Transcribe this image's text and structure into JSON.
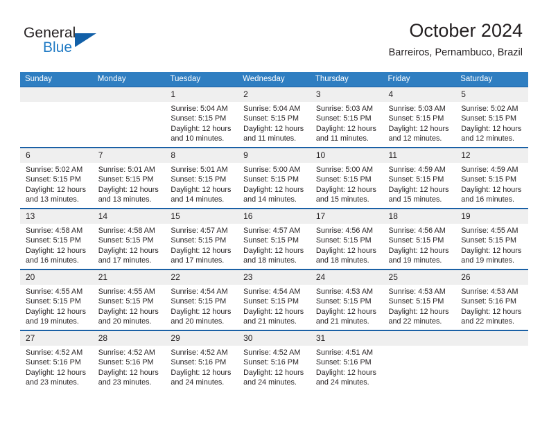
{
  "brand": {
    "name_top": "General",
    "name_bottom": "Blue",
    "triangle_color": "#1260a8",
    "blue_text_color": "#1f7ac4"
  },
  "header": {
    "title": "October 2024",
    "subtitle": "Barreiros, Pernambuco, Brazil"
  },
  "theme": {
    "header_bg": "#2f7ec1",
    "row_border": "#1a60a5",
    "daynum_bg": "#efefef",
    "text": "#231f20"
  },
  "weekday_headers": [
    "Sunday",
    "Monday",
    "Tuesday",
    "Wednesday",
    "Thursday",
    "Friday",
    "Saturday"
  ],
  "weeks": [
    [
      {
        "day": "",
        "blank": true
      },
      {
        "day": "",
        "blank": true
      },
      {
        "day": "1",
        "sunrise": "Sunrise: 5:04 AM",
        "sunset": "Sunset: 5:15 PM",
        "daylight_line1": "Daylight: 12 hours",
        "daylight_line2": "and 10 minutes."
      },
      {
        "day": "2",
        "sunrise": "Sunrise: 5:04 AM",
        "sunset": "Sunset: 5:15 PM",
        "daylight_line1": "Daylight: 12 hours",
        "daylight_line2": "and 11 minutes."
      },
      {
        "day": "3",
        "sunrise": "Sunrise: 5:03 AM",
        "sunset": "Sunset: 5:15 PM",
        "daylight_line1": "Daylight: 12 hours",
        "daylight_line2": "and 11 minutes."
      },
      {
        "day": "4",
        "sunrise": "Sunrise: 5:03 AM",
        "sunset": "Sunset: 5:15 PM",
        "daylight_line1": "Daylight: 12 hours",
        "daylight_line2": "and 12 minutes."
      },
      {
        "day": "5",
        "sunrise": "Sunrise: 5:02 AM",
        "sunset": "Sunset: 5:15 PM",
        "daylight_line1": "Daylight: 12 hours",
        "daylight_line2": "and 12 minutes."
      }
    ],
    [
      {
        "day": "6",
        "sunrise": "Sunrise: 5:02 AM",
        "sunset": "Sunset: 5:15 PM",
        "daylight_line1": "Daylight: 12 hours",
        "daylight_line2": "and 13 minutes."
      },
      {
        "day": "7",
        "sunrise": "Sunrise: 5:01 AM",
        "sunset": "Sunset: 5:15 PM",
        "daylight_line1": "Daylight: 12 hours",
        "daylight_line2": "and 13 minutes."
      },
      {
        "day": "8",
        "sunrise": "Sunrise: 5:01 AM",
        "sunset": "Sunset: 5:15 PM",
        "daylight_line1": "Daylight: 12 hours",
        "daylight_line2": "and 14 minutes."
      },
      {
        "day": "9",
        "sunrise": "Sunrise: 5:00 AM",
        "sunset": "Sunset: 5:15 PM",
        "daylight_line1": "Daylight: 12 hours",
        "daylight_line2": "and 14 minutes."
      },
      {
        "day": "10",
        "sunrise": "Sunrise: 5:00 AM",
        "sunset": "Sunset: 5:15 PM",
        "daylight_line1": "Daylight: 12 hours",
        "daylight_line2": "and 15 minutes."
      },
      {
        "day": "11",
        "sunrise": "Sunrise: 4:59 AM",
        "sunset": "Sunset: 5:15 PM",
        "daylight_line1": "Daylight: 12 hours",
        "daylight_line2": "and 15 minutes."
      },
      {
        "day": "12",
        "sunrise": "Sunrise: 4:59 AM",
        "sunset": "Sunset: 5:15 PM",
        "daylight_line1": "Daylight: 12 hours",
        "daylight_line2": "and 16 minutes."
      }
    ],
    [
      {
        "day": "13",
        "sunrise": "Sunrise: 4:58 AM",
        "sunset": "Sunset: 5:15 PM",
        "daylight_line1": "Daylight: 12 hours",
        "daylight_line2": "and 16 minutes."
      },
      {
        "day": "14",
        "sunrise": "Sunrise: 4:58 AM",
        "sunset": "Sunset: 5:15 PM",
        "daylight_line1": "Daylight: 12 hours",
        "daylight_line2": "and 17 minutes."
      },
      {
        "day": "15",
        "sunrise": "Sunrise: 4:57 AM",
        "sunset": "Sunset: 5:15 PM",
        "daylight_line1": "Daylight: 12 hours",
        "daylight_line2": "and 17 minutes."
      },
      {
        "day": "16",
        "sunrise": "Sunrise: 4:57 AM",
        "sunset": "Sunset: 5:15 PM",
        "daylight_line1": "Daylight: 12 hours",
        "daylight_line2": "and 18 minutes."
      },
      {
        "day": "17",
        "sunrise": "Sunrise: 4:56 AM",
        "sunset": "Sunset: 5:15 PM",
        "daylight_line1": "Daylight: 12 hours",
        "daylight_line2": "and 18 minutes."
      },
      {
        "day": "18",
        "sunrise": "Sunrise: 4:56 AM",
        "sunset": "Sunset: 5:15 PM",
        "daylight_line1": "Daylight: 12 hours",
        "daylight_line2": "and 19 minutes."
      },
      {
        "day": "19",
        "sunrise": "Sunrise: 4:55 AM",
        "sunset": "Sunset: 5:15 PM",
        "daylight_line1": "Daylight: 12 hours",
        "daylight_line2": "and 19 minutes."
      }
    ],
    [
      {
        "day": "20",
        "sunrise": "Sunrise: 4:55 AM",
        "sunset": "Sunset: 5:15 PM",
        "daylight_line1": "Daylight: 12 hours",
        "daylight_line2": "and 19 minutes."
      },
      {
        "day": "21",
        "sunrise": "Sunrise: 4:55 AM",
        "sunset": "Sunset: 5:15 PM",
        "daylight_line1": "Daylight: 12 hours",
        "daylight_line2": "and 20 minutes."
      },
      {
        "day": "22",
        "sunrise": "Sunrise: 4:54 AM",
        "sunset": "Sunset: 5:15 PM",
        "daylight_line1": "Daylight: 12 hours",
        "daylight_line2": "and 20 minutes."
      },
      {
        "day": "23",
        "sunrise": "Sunrise: 4:54 AM",
        "sunset": "Sunset: 5:15 PM",
        "daylight_line1": "Daylight: 12 hours",
        "daylight_line2": "and 21 minutes."
      },
      {
        "day": "24",
        "sunrise": "Sunrise: 4:53 AM",
        "sunset": "Sunset: 5:15 PM",
        "daylight_line1": "Daylight: 12 hours",
        "daylight_line2": "and 21 minutes."
      },
      {
        "day": "25",
        "sunrise": "Sunrise: 4:53 AM",
        "sunset": "Sunset: 5:15 PM",
        "daylight_line1": "Daylight: 12 hours",
        "daylight_line2": "and 22 minutes."
      },
      {
        "day": "26",
        "sunrise": "Sunrise: 4:53 AM",
        "sunset": "Sunset: 5:16 PM",
        "daylight_line1": "Daylight: 12 hours",
        "daylight_line2": "and 22 minutes."
      }
    ],
    [
      {
        "day": "27",
        "sunrise": "Sunrise: 4:52 AM",
        "sunset": "Sunset: 5:16 PM",
        "daylight_line1": "Daylight: 12 hours",
        "daylight_line2": "and 23 minutes."
      },
      {
        "day": "28",
        "sunrise": "Sunrise: 4:52 AM",
        "sunset": "Sunset: 5:16 PM",
        "daylight_line1": "Daylight: 12 hours",
        "daylight_line2": "and 23 minutes."
      },
      {
        "day": "29",
        "sunrise": "Sunrise: 4:52 AM",
        "sunset": "Sunset: 5:16 PM",
        "daylight_line1": "Daylight: 12 hours",
        "daylight_line2": "and 24 minutes."
      },
      {
        "day": "30",
        "sunrise": "Sunrise: 4:52 AM",
        "sunset": "Sunset: 5:16 PM",
        "daylight_line1": "Daylight: 12 hours",
        "daylight_line2": "and 24 minutes."
      },
      {
        "day": "31",
        "sunrise": "Sunrise: 4:51 AM",
        "sunset": "Sunset: 5:16 PM",
        "daylight_line1": "Daylight: 12 hours",
        "daylight_line2": "and 24 minutes."
      },
      {
        "day": "",
        "blank": true
      },
      {
        "day": "",
        "blank": true
      }
    ]
  ]
}
